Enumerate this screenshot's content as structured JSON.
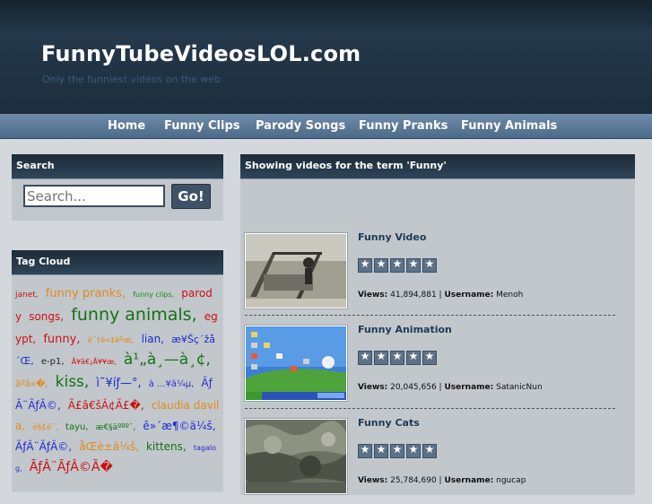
{
  "header": {
    "title": "FunnyTubeVideosLOL.com",
    "tagline": "Only the funniest videos on the web"
  },
  "nav": {
    "items": [
      "Home",
      "Funny Clips",
      "Parody Songs",
      "Funny Pranks",
      "Funny Animals"
    ]
  },
  "search": {
    "heading": "Search",
    "placeholder": "Search...",
    "button_label": "Go!"
  },
  "tagcloud": {
    "heading": "Tag Cloud",
    "tags": [
      {
        "text": "janet,",
        "color": "red"
      },
      {
        "text": "funny pranks,",
        "color": "orange"
      },
      {
        "text": "funny clips,",
        "color": "green"
      },
      {
        "text": "parody",
        "color": "red"
      },
      {
        "text": "songs,",
        "color": "red"
      },
      {
        "text": "funny animals,",
        "color": "dgreen"
      },
      {
        "text": "egypt,",
        "color": "red"
      },
      {
        "text": "funny,",
        "color": "red"
      },
      {
        "text": "è¨†è«‡äºœ,",
        "color": "orange"
      },
      {
        "text": "lian,",
        "color": "blue"
      },
      {
        "text": "æ¥Šç´žå´Œ,",
        "color": "blue"
      },
      {
        "text": "e-p1,",
        "color": "dark"
      },
      {
        "text": "Ã¥â€¡Ã¥¥œ,",
        "color": "red"
      },
      {
        "text": "à¹„à¸—à¸¢,",
        "color": "dgreen"
      },
      {
        "text": "ãºã«�,",
        "color": "orange"
      },
      {
        "text": "kiss,",
        "color": "dgreen"
      },
      {
        "text": "ì˜¥íƒ—°,",
        "color": "blue"
      },
      {
        "text": "à ...¥ä¼µ,",
        "color": "purple"
      },
      {
        "text": "ÃƒÂ¨ÃƒÂ©,",
        "color": "purple"
      },
      {
        "text": "Ã£â€šÂ¢Ã£�,",
        "color": "red"
      },
      {
        "text": "claudia davila,",
        "color": "orange"
      },
      {
        "text": "è§£è¨,",
        "color": "orange"
      },
      {
        "text": "tayu,",
        "color": "dgreen"
      },
      {
        "text": "æ€§äººº¯,",
        "color": "dgreen"
      },
      {
        "text": "ê»´æ¶©ä¼š,",
        "color": "blue"
      },
      {
        "text": "ÃƒÂ¨ÃƒÂ©,",
        "color": "blue"
      },
      {
        "text": "åŒè±ä¼š,",
        "color": "orange"
      },
      {
        "text": "kittens,",
        "color": "dgreen"
      },
      {
        "text": "tagalog,",
        "color": "purple"
      },
      {
        "text": "ÃƒÂ¨ÃƒÂ©Ã�",
        "color": "red"
      }
    ]
  },
  "results": {
    "heading": "Showing videos for the term 'Funny'",
    "views_label": "Views:",
    "username_label": "Username:",
    "videos": [
      {
        "title": "Funny Video",
        "views": "41,894,881",
        "username": "Menoh",
        "thumb": "playground"
      },
      {
        "title": "Funny Animation",
        "views": "20,045,656",
        "username": "SatanicNun",
        "thumb": "desktop"
      },
      {
        "title": "Funny Cats",
        "views": "25,784,690",
        "username": "ngucap",
        "thumb": "cats"
      }
    ]
  },
  "colors": {
    "header_bg": "#1d2d3c",
    "nav_bg": "#5a7896",
    "panel_bg": "#c2c7cc",
    "link_blue": "#1e3a55"
  }
}
